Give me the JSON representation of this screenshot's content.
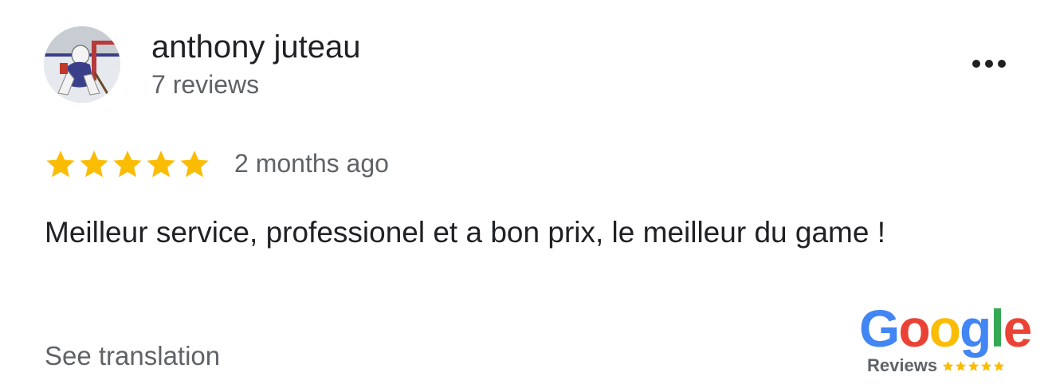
{
  "review": {
    "author": {
      "name": "anthony juteau",
      "review_count": "7 reviews",
      "avatar_icon": "hockey-goalie-photo"
    },
    "more_icon": "more-horizontal-icon",
    "rating": 5,
    "rating_max": 5,
    "timestamp": "2 months ago",
    "text": "Meilleur service, professionel et a bon prix, le meilleur du game !",
    "see_translation": "See translation"
  },
  "badge": {
    "google_letters": [
      "G",
      "o",
      "o",
      "g",
      "l",
      "e"
    ],
    "label": "Reviews",
    "stars": 5
  },
  "colors": {
    "star": "#fbbc04",
    "text_primary": "#202124",
    "text_secondary": "#5f6368",
    "google_blue": "#4285f4",
    "google_red": "#ea4335",
    "google_yellow": "#fbbc05",
    "google_green": "#34a853"
  }
}
